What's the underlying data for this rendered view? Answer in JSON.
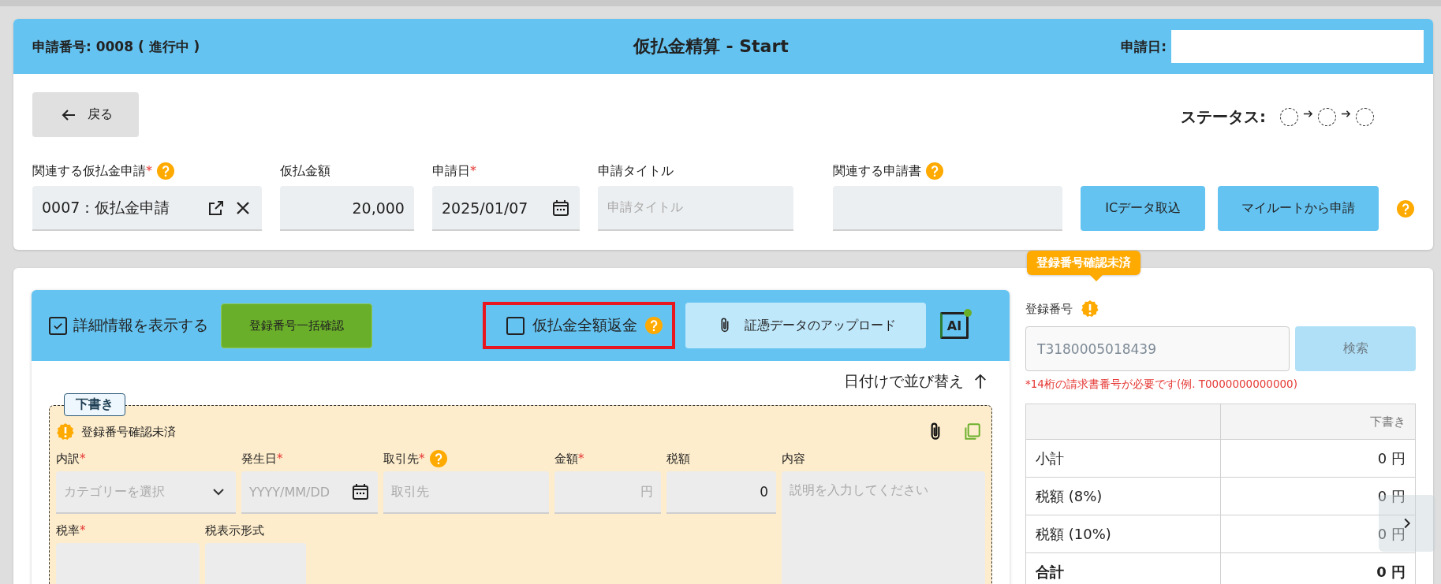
{
  "header": {
    "number": "申請番号: 0008 ( 進行中 )",
    "title": "仮払金精算 - Start",
    "date_label": "申請日:"
  },
  "back_button": {
    "label": "戻る"
  },
  "status": {
    "label": "ステータス:",
    "steps": [
      {
        "completed": false
      },
      {
        "completed": false
      },
      {
        "completed": false
      }
    ]
  },
  "fields": [
    {
      "label": "関連する仮払金申請",
      "required_mark": "*",
      "help": true,
      "kind": "link",
      "value": "0007：仮払金申請"
    },
    {
      "label": "仮払金額",
      "kind": "amount",
      "value": "20,000"
    },
    {
      "label": "申請日",
      "required_mark": "*",
      "kind": "date",
      "value": "2025/01/07"
    },
    {
      "label": "申請タイトル",
      "kind": "text",
      "placeholder": "申請タイトル"
    },
    {
      "label": "関連する申請書",
      "help": true,
      "kind": "empty"
    }
  ],
  "actions": [
    "ICデータ取込",
    "マイルートから申請"
  ],
  "toolbar": {
    "show_details": {
      "label": "詳細情報を表示する",
      "checked": true
    },
    "bulk_check": "登録番号一括確認",
    "full_refund": {
      "label": "仮払金全額返金",
      "checked": false,
      "highlighted": true
    },
    "upload": "証憑データのアップロード",
    "ai_badge": "AI"
  },
  "sort": {
    "label": "日付けで並び替え"
  },
  "draft": {
    "tag": "下書き",
    "warning": "登録番号確認未済",
    "row_1": [
      {
        "label": "内訳",
        "required_mark": "*",
        "kind": "select",
        "placeholder": "カテゴリーを選択"
      },
      {
        "label": "発生日",
        "required_mark": "*",
        "kind": "date",
        "placeholder": "YYYY/MM/DD"
      },
      {
        "label": "取引先",
        "required_mark": "*",
        "help": true,
        "kind": "text",
        "placeholder": "取引先"
      },
      {
        "label": "金額",
        "required_mark": "*",
        "kind": "amount",
        "placeholder": "円"
      },
      {
        "label": "税額",
        "kind": "amount",
        "value": "0"
      }
    ],
    "row_2": [
      {
        "label": "税率",
        "required_mark": "*"
      },
      {
        "label": "税表示形式"
      }
    ],
    "description": {
      "label": "内容",
      "placeholder": "説明を入力してください"
    }
  },
  "registration": {
    "tooltip": "登録番号確認未済",
    "label": "登録番号",
    "placeholder": "T3180005018439",
    "search": {
      "label": "検索",
      "disabled": true
    },
    "note": "*14桁の請求書番号が必要です(例. T0000000000000)"
  },
  "summary": {
    "header": "下書き",
    "rows": [
      {
        "label": "小計",
        "value": "0 円",
        "total": false
      },
      {
        "label": "税額 (8%)",
        "value": "0 円",
        "total": false
      },
      {
        "label": "税額 (10%)",
        "value": "0 円",
        "total": false
      },
      {
        "label": "合計",
        "value": "0 円",
        "total": true
      }
    ]
  }
}
